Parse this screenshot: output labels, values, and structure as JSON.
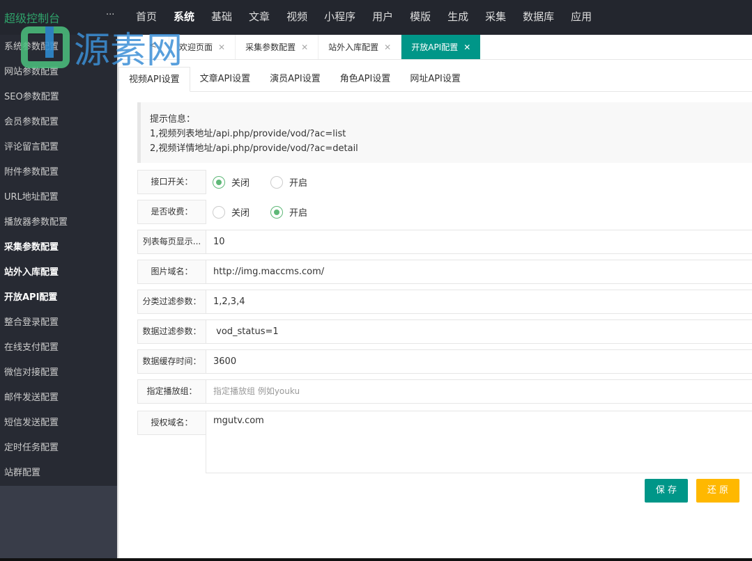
{
  "header": {
    "brand": "超级控制台",
    "more": "···",
    "nav": [
      "首页",
      "系统",
      "基础",
      "文章",
      "视频",
      "小程序",
      "用户",
      "模版",
      "生成",
      "采集",
      "数据库",
      "应用"
    ],
    "active": "系统"
  },
  "watermark": "源素网",
  "sidebar": {
    "items": [
      "系统参数配置",
      "网站参数配置",
      "SEO参数配置",
      "会员参数配置",
      "评论留言配置",
      "附件参数配置",
      "URL地址配置",
      "播放器参数配置",
      "采集参数配置",
      "站外入库配置",
      "开放API配置",
      "整合登录配置",
      "在线支付配置",
      "微信对接配置",
      "邮件发送配置",
      "短信发送配置",
      "定时任务配置",
      "站群配置"
    ]
  },
  "tabs": [
    "欢迎页面",
    "采集参数配置",
    "站外入库配置",
    "开放API配置"
  ],
  "subtabs": [
    "视频API设置",
    "文章API设置",
    "演员API设置",
    "角色API设置",
    "网址API设置"
  ],
  "tip": {
    "title": "提示信息：",
    "line1": "1,视频列表地址/api.php/provide/vod/?ac=list",
    "line2": "2,视频详情地址/api.php/provide/vod/?ac=detail"
  },
  "form": {
    "switch": {
      "label": "接口开关：",
      "options": [
        "关闭",
        "开启"
      ],
      "selected": "关闭"
    },
    "charge": {
      "label": "是否收费：",
      "options": [
        "关闭",
        "开启"
      ],
      "selected": "开启"
    },
    "fields": [
      {
        "label": "列表每页显示...",
        "value": "10"
      },
      {
        "label": "图片域名：",
        "value": "http://img.maccms.com/"
      },
      {
        "label": "分类过滤参数：",
        "value": "1,2,3,4"
      },
      {
        "label": "数据过滤参数：",
        "value": " vod_status=1"
      },
      {
        "label": "数据缓存时间：",
        "value": "3600"
      },
      {
        "label": "指定播放组：",
        "placeholder": "指定播放组 例如youku"
      }
    ],
    "auth": {
      "label": "授权域名：",
      "value": "mgutv.com"
    }
  },
  "buttons": {
    "save": "保 存",
    "reset": "还 原"
  },
  "colors": {
    "accent": "#009688",
    "warn": "#ffb800",
    "radio": "#5fb878"
  }
}
